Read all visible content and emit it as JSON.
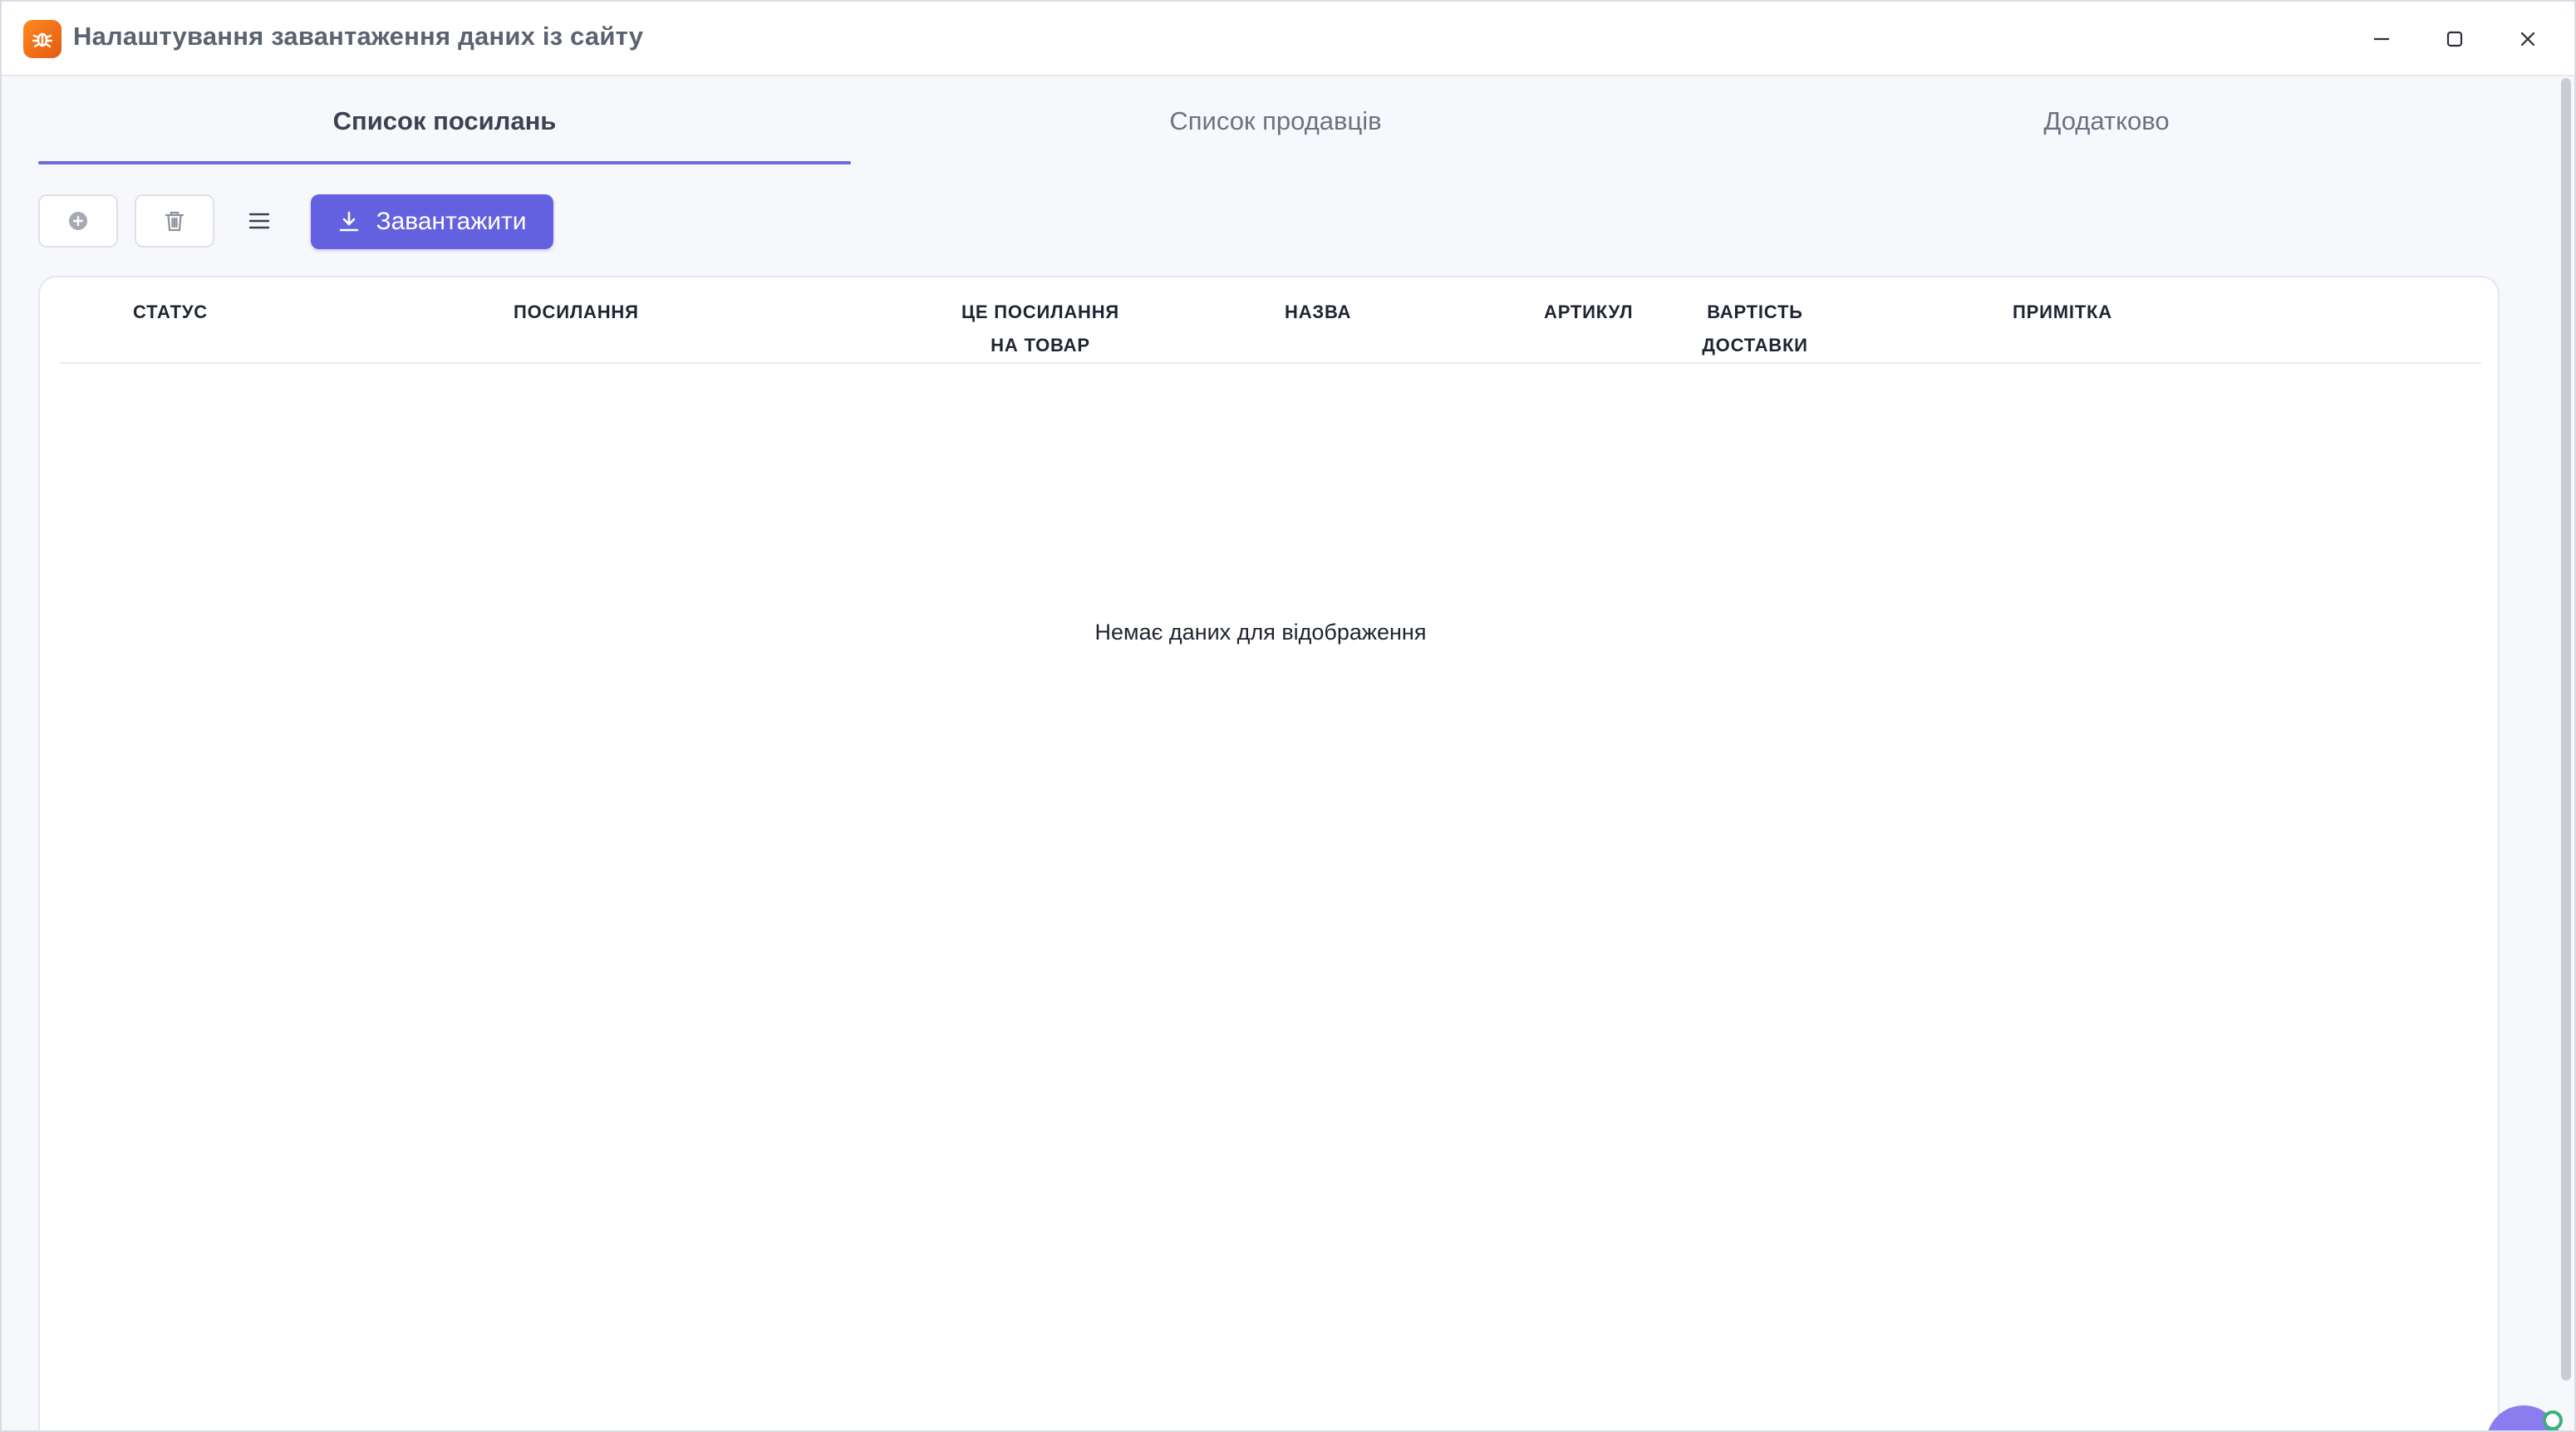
{
  "window": {
    "title": "Налаштування завантаження даних із сайту",
    "app_icon": "parser-app-icon",
    "controls": [
      "minimize-icon",
      "maximize-icon",
      "close-icon"
    ]
  },
  "tabs": [
    {
      "label": "Список посилань",
      "active": true
    },
    {
      "label": "Список продавців",
      "active": false
    },
    {
      "label": "Додатково",
      "active": false
    }
  ],
  "toolbar": {
    "add_icon": "plus-circle-icon",
    "delete_icon": "trash-icon",
    "menu_icon": "hamburger-menu-icon",
    "download_label": "Завантажити",
    "download_icon": "download-icon"
  },
  "grid": {
    "columns": [
      {
        "line1": "Статус",
        "line2": ""
      },
      {
        "line1": "Посилання",
        "line2": ""
      },
      {
        "line1": "Це посилання",
        "line2": "на товар"
      },
      {
        "line1": "Назва",
        "line2": ""
      },
      {
        "line1": "Артикул",
        "line2": ""
      },
      {
        "line1": "Вартість",
        "line2": "доставки"
      },
      {
        "line1": "Примітка",
        "line2": ""
      }
    ],
    "rows": [],
    "empty_message": "Немає даних для відображення"
  },
  "colors": {
    "accent": "#6361df",
    "tab_underline": "#6d6bd8",
    "app_icon": "#e35a12",
    "status_dot": "#39b37a"
  }
}
